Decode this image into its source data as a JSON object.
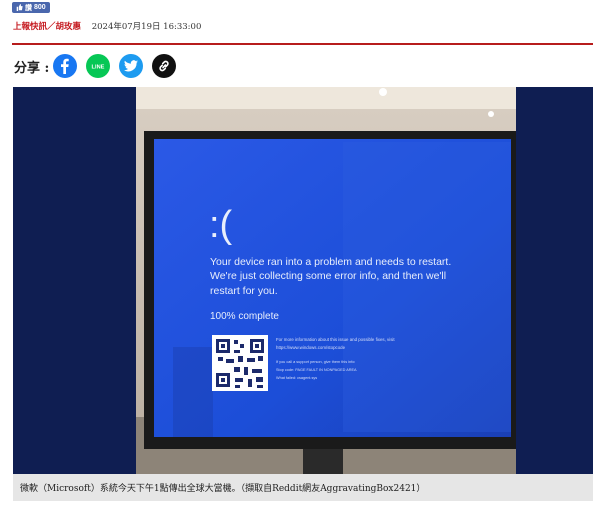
{
  "like": {
    "count": "800",
    "label": "讚"
  },
  "byline": {
    "source": "上報快訊／胡玫惠",
    "datetime": "2024年07月19日 16:33:00"
  },
  "share": {
    "label": "分享 :",
    "buttons": [
      {
        "name": "facebook",
        "icon": "facebook-icon"
      },
      {
        "name": "line",
        "text": "LINE",
        "icon": "line-icon"
      },
      {
        "name": "twitter",
        "icon": "twitter-icon"
      },
      {
        "name": "copy-link",
        "icon": "link-icon"
      }
    ]
  },
  "photo": {
    "screen": {
      "face": ":(",
      "message_lines": [
        "Your device ran into a problem and needs to restart.",
        "We're just collecting some error info, and then we'll",
        "restart for you."
      ],
      "progress": "100% complete",
      "info_lines": [
        "For more information about this issue and possible fixes, visit",
        "https://www.windows.com/stopcode",
        "If you call a support person, give them this info:",
        "Stop code: PAGE FAULT IN NONPAGED AREA",
        "What failed: csagent.sys"
      ],
      "bg_color": "#1c4ed8"
    }
  },
  "caption": "微軟（Microsoft）系統今天下午1點傳出全球大當機。（擷取自Reddit網友AggravatingBox2421）"
}
